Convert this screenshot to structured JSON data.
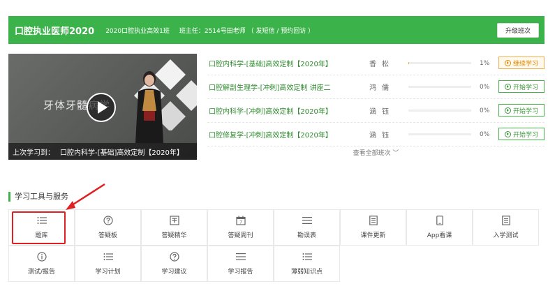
{
  "header": {
    "course_title": "口腔执业医师2020",
    "class_name": "2020口腔执业高效1班",
    "teacher_info": "班主任：2514号田老师 （ 发短信 / 预约回访 ）",
    "upgrade_label": "升级班次",
    "bg_color": "#3cb34a"
  },
  "video": {
    "overlay_title": "牙体牙髓病学",
    "last_study_prefix": "上次学习到：",
    "last_study_course": "口腔内科学-[基础]高效定制【2020年】"
  },
  "courses": [
    {
      "name": "口腔内科学-[基础]高效定制【2020年】",
      "teacher": "香松",
      "progress": 0.01,
      "progress_label": "1%",
      "action": "继续学习",
      "status": "continue"
    },
    {
      "name": "口腔解剖生理学-[冲刺]高效定制 讲座二",
      "teacher": "鸿儒",
      "progress": 0,
      "progress_label": "0%",
      "action": "开始学习",
      "status": "start"
    },
    {
      "name": "口腔内科学-[冲刺]高效定制【2020年】",
      "teacher": "涵钰",
      "progress": 0,
      "progress_label": "0%",
      "action": "开始学习",
      "status": "start"
    },
    {
      "name": "口腔修复学-[冲刺]高效定制【2020年】",
      "teacher": "涵钰",
      "progress": 0,
      "progress_label": "0%",
      "action": "开始学习",
      "status": "start"
    }
  ],
  "view_all": "查看全部班次 ﹀",
  "tools_title": "学习工具与服务",
  "tools": [
    {
      "label": "题库",
      "icon": "list-icon"
    },
    {
      "label": "答疑板",
      "icon": "question-circle-icon"
    },
    {
      "label": "答疑精华",
      "icon": "grid-box-icon"
    },
    {
      "label": "答疑周刊",
      "icon": "calendar-icon"
    },
    {
      "label": "勘误表",
      "icon": "menu-lines-icon"
    },
    {
      "label": "课件更新",
      "icon": "document-icon"
    },
    {
      "label": "App看课",
      "icon": "phone-icon"
    },
    {
      "label": "入学测试",
      "icon": "document-icon"
    },
    {
      "label": "测试/报告",
      "icon": "info-circle-icon"
    },
    {
      "label": "学习计划",
      "icon": "list-icon"
    },
    {
      "label": "学习建议",
      "icon": "question-circle-icon"
    },
    {
      "label": "学习报告",
      "icon": "menu-lines-icon"
    },
    {
      "label": "薄弱知识点",
      "icon": "list-icon"
    }
  ],
  "accent_orange": "#f5a623",
  "annotation_color": "#e02020"
}
